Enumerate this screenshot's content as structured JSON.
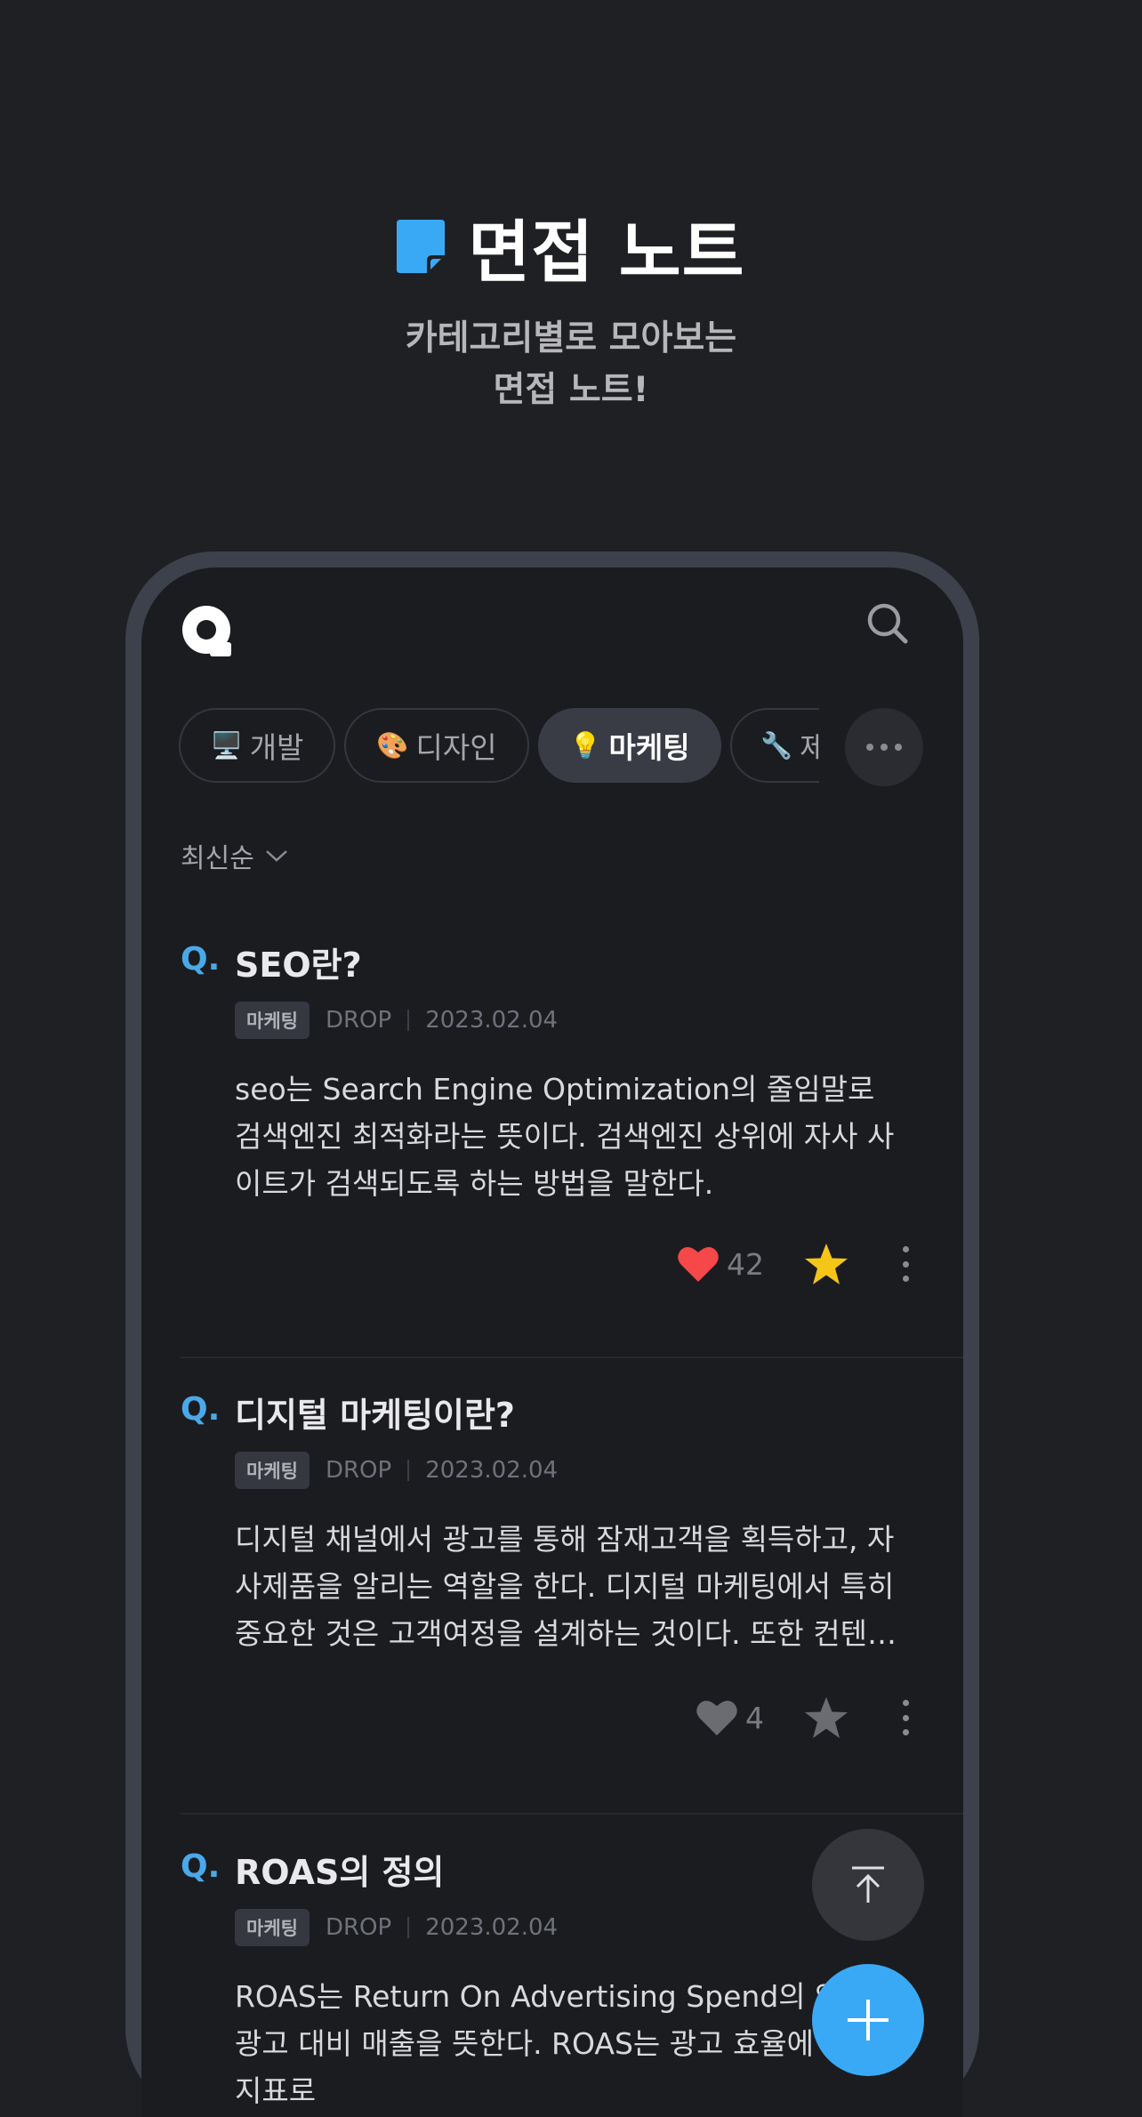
{
  "hero": {
    "title": "면접 노트",
    "subtitle_line1": "카테고리별로 모아보는",
    "subtitle_line2": "면접 노트!"
  },
  "colors": {
    "accent": "#3aa9f5",
    "heart_active": "#f64848",
    "star_active": "#f5c518",
    "background": "#1f2024"
  },
  "header": {
    "logo_icon": "q-logo-icon",
    "search_icon": "search-icon"
  },
  "categories": [
    {
      "emoji": "🖥️",
      "label": "개발",
      "active": false
    },
    {
      "emoji": "🎨",
      "label": "디자인",
      "active": false
    },
    {
      "emoji": "💡",
      "label": "마케팅",
      "active": true
    },
    {
      "emoji": "🔧",
      "label": "제",
      "active": false
    }
  ],
  "sort": {
    "label": "최신순"
  },
  "questions": [
    {
      "q_marker": "Q.",
      "title": "SEO란?",
      "tag": "마케팅",
      "author": "DROP",
      "date": "2023.02.04",
      "body": "seo는 Search Engine Optimization의 줄임말로 검색엔진 최적화라는 뜻이다. 검색엔진 상위에 자사 사이트가 검색되도록 하는 방법을 말한다.",
      "likes": "42",
      "liked": true,
      "starred": true
    },
    {
      "q_marker": "Q.",
      "title": "디지털 마케팅이란?",
      "tag": "마케팅",
      "author": "DROP",
      "date": "2023.02.04",
      "body": "디지털 채널에서 광고를 통해 잠재고객을 획득하고, 자사제품을 알리는 역할을 한다. 디지털 마케팅에서 특히 중요한 것은 고객여정을 설계하는 것이다. 또한 컨텐츠를 통해",
      "likes": "4",
      "liked": false,
      "starred": false
    },
    {
      "q_marker": "Q.",
      "title": "ROAS의 정의",
      "tag": "마케팅",
      "author": "DROP",
      "date": "2023.02.04",
      "body": "ROAS는 Return On Advertising Spend의 약자로 광고 대비 매출을 뜻한다. ROAS는 광고 효율에 대한 지표로",
      "likes": "",
      "liked": false,
      "starred": false
    }
  ]
}
